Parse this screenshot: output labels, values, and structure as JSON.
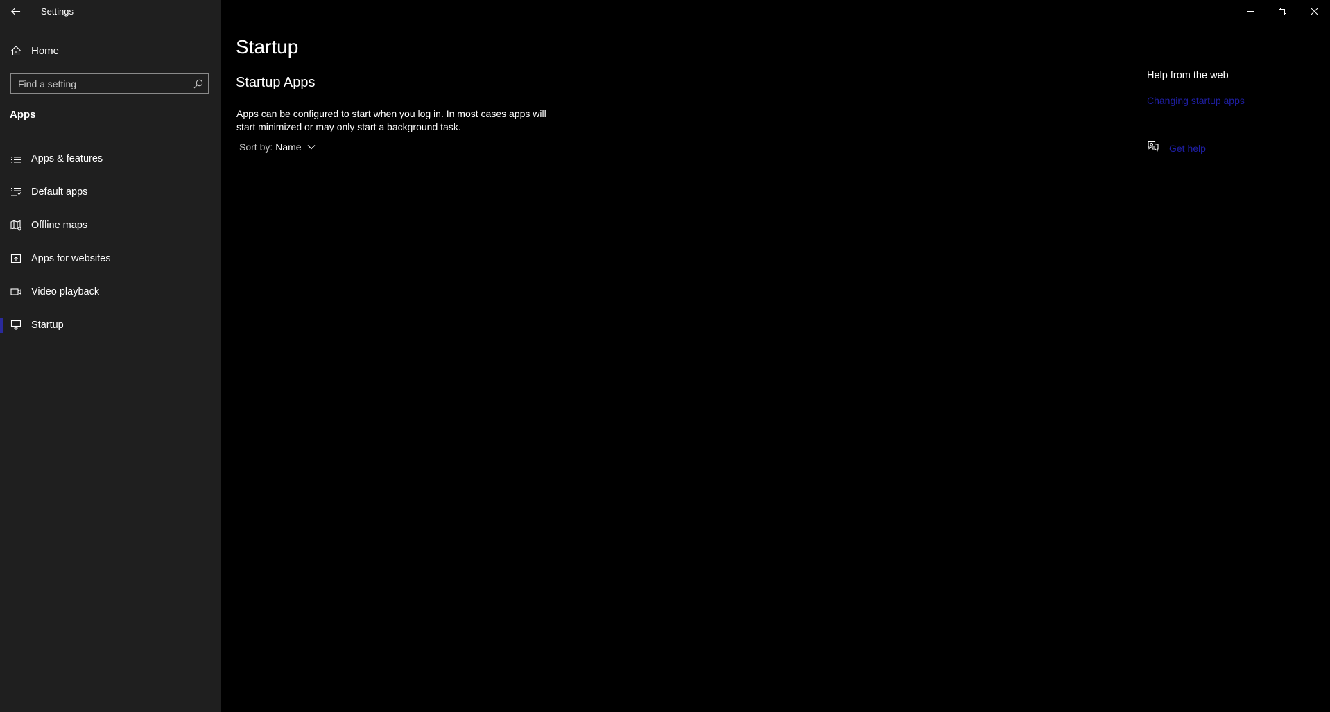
{
  "window": {
    "title": "Settings",
    "controls": [
      "minimize",
      "restore",
      "close"
    ]
  },
  "sidebar": {
    "home_label": "Home",
    "search_placeholder": "Find a setting",
    "section_title": "Apps",
    "items": [
      {
        "label": "Apps & features",
        "icon": "list-icon",
        "active": false
      },
      {
        "label": "Default apps",
        "icon": "default-apps-icon",
        "active": false
      },
      {
        "label": "Offline maps",
        "icon": "map-icon",
        "active": false
      },
      {
        "label": "Apps for websites",
        "icon": "app-website-icon",
        "active": false
      },
      {
        "label": "Video playback",
        "icon": "video-icon",
        "active": false
      },
      {
        "label": "Startup",
        "icon": "startup-icon",
        "active": true
      }
    ]
  },
  "main": {
    "page_title": "Startup",
    "sub_title": "Startup Apps",
    "description": "Apps can be configured to start when you log in. In most cases apps will start minimized or may only start a background task.",
    "sort_label": "Sort by:",
    "sort_value": "Name"
  },
  "help": {
    "title": "Help from the web",
    "link": "Changing startup apps",
    "get_help": "Get help"
  },
  "colors": {
    "sidebar_bg": "#1f1f1f",
    "main_bg": "#000000",
    "accent": "#2a2a9c",
    "link": "#1f1fa6"
  }
}
